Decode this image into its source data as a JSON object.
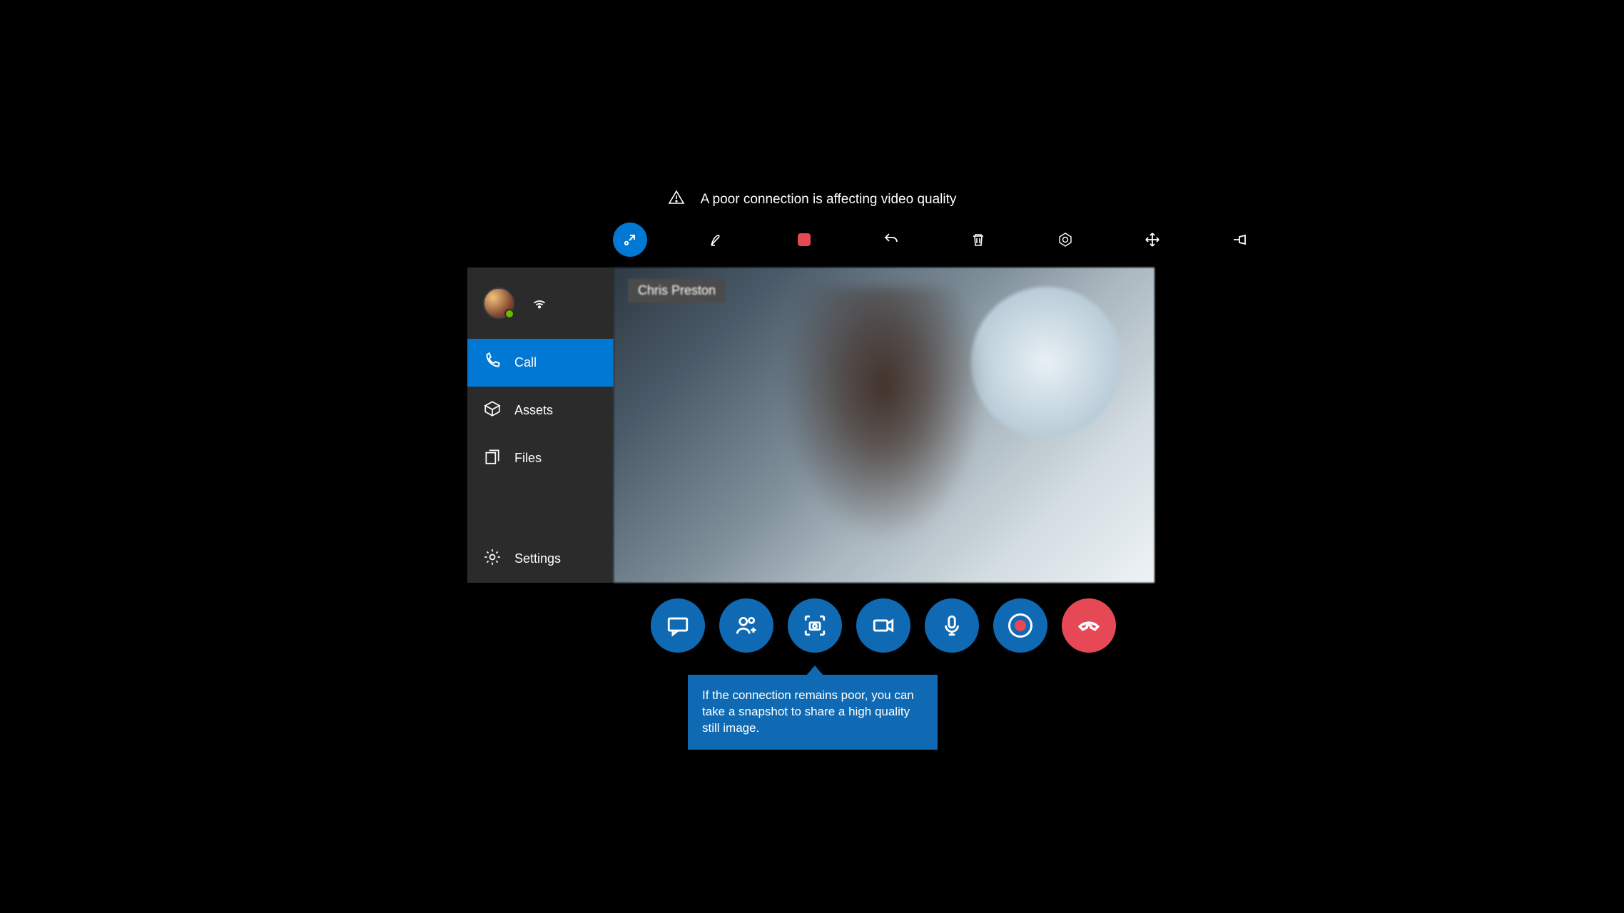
{
  "colors": {
    "accent": "#0078d4",
    "actionBlue": "#0f6ab3",
    "danger": "#e74856"
  },
  "warning": {
    "text": "A poor connection is affecting video quality"
  },
  "toolbar_icons": [
    "pointer-collapse-icon",
    "pen-icon",
    "stop-icon",
    "undo-icon",
    "trash-icon",
    "aperture-icon",
    "move-icon",
    "pin-icon"
  ],
  "participant": {
    "name": "Chris Preston"
  },
  "sidebar": {
    "items": [
      {
        "icon": "phone-icon",
        "label": "Call",
        "selected": true
      },
      {
        "icon": "box-icon",
        "label": "Assets",
        "selected": false
      },
      {
        "icon": "files-icon",
        "label": "Files",
        "selected": false
      },
      {
        "icon": "gear-icon",
        "label": "Settings",
        "selected": false
      }
    ]
  },
  "callbar_icons": [
    "chat-icon",
    "add-people-icon",
    "snapshot-icon",
    "video-icon",
    "mic-icon",
    "record-icon",
    "hangup-icon"
  ],
  "tooltip": {
    "for_icon": "snapshot-icon",
    "text": "If the connection remains poor, you can take a snapshot to share a high quality still image."
  }
}
